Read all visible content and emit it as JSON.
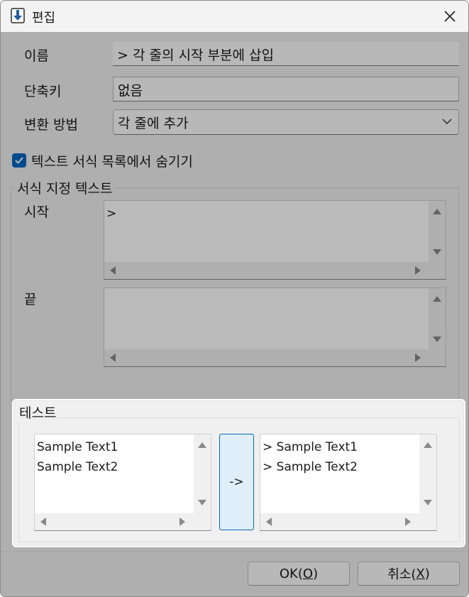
{
  "window": {
    "title": "편집",
    "close_symbol": "✕",
    "icon": "download-arrow-icon"
  },
  "form": {
    "name_label": "이름",
    "name_value": "> 각 줄의 시작 부분에 삽입",
    "shortcut_label": "단축키",
    "shortcut_value": "없음",
    "method_label": "변환 방법",
    "method_value": "각 줄에 추가",
    "hide_checkbox_label": "텍스트 서식 목록에서 숨기기",
    "hide_checkbox_checked": true
  },
  "format_group": {
    "title": "서식 지정 텍스트",
    "start_label": "시작",
    "start_value": ">",
    "end_label": "끝",
    "end_value": ""
  },
  "test_group": {
    "title": "테스트",
    "input_text": "Sample Text1\nSample Text2",
    "convert_button": "->",
    "output_text": "> Sample Text1\n> Sample Text2"
  },
  "footer": {
    "ok_prefix": "OK(",
    "ok_key": "O",
    "ok_suffix": ")",
    "cancel_prefix": "취소(",
    "cancel_key": "X",
    "cancel_suffix": ")"
  },
  "colors": {
    "accent": "#0067c0",
    "dim_overlay": "rgba(0,0,0,0.27)"
  }
}
